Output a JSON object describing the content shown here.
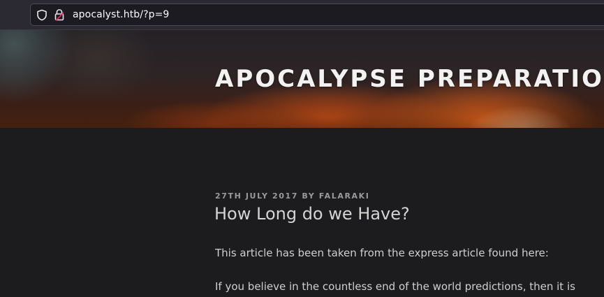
{
  "browser": {
    "url": "apocalyst.htb/?p=9",
    "icons": [
      "shield-icon",
      "lock-icon"
    ]
  },
  "header": {
    "site_title": "APOCALYPSE PREPARATIO"
  },
  "post": {
    "meta": "27TH JULY 2017 BY FALARAKI",
    "title": "How Long do we Have?",
    "paragraphs": [
      "This article has been taken from the express article found here:",
      "If you believe in the countless end of the world predictions, then it is"
    ]
  },
  "colors": {
    "page_background": "#1c1c1e",
    "browser_background": "#2b2a33",
    "title_text": "#f2f2f2",
    "meta_text": "#9a9a9a",
    "body_text": "#cfcfcf"
  }
}
